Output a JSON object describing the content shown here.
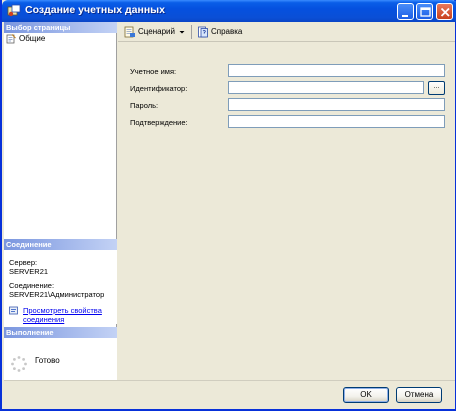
{
  "window": {
    "title": "Создание учетных данных"
  },
  "left_panel": {
    "select_page_header": "Выбор страницы",
    "nav_items": [
      {
        "label": "Общие",
        "icon": "page-icon"
      }
    ],
    "connection_header": "Соединение",
    "server_label": "Сервер:",
    "server_value": "SERVER21",
    "connection_label": "Соединение:",
    "connection_value": "SERVER21\\Администратор",
    "view_properties_link": "Просмотреть свойства соединения",
    "progress_header": "Выполнение",
    "status_text": "Готово"
  },
  "toolbar": {
    "script_label": "Сценарий",
    "help_label": "Справка"
  },
  "form": {
    "credential_name_label": "Учетное имя:",
    "credential_name_value": "",
    "identity_label": "Идентификатор:",
    "identity_value": "",
    "browse_label": "...",
    "password_label": "Пароль:",
    "password_value": "",
    "confirm_label": "Подтверждение:",
    "confirm_value": ""
  },
  "buttons": {
    "ok_label": "OK",
    "cancel_label": "Отмена"
  },
  "colors": {
    "titlebar": "#0a5ee8",
    "section_header": "#7a96df",
    "window_bg": "#ece9d8",
    "link": "#0000ee"
  }
}
